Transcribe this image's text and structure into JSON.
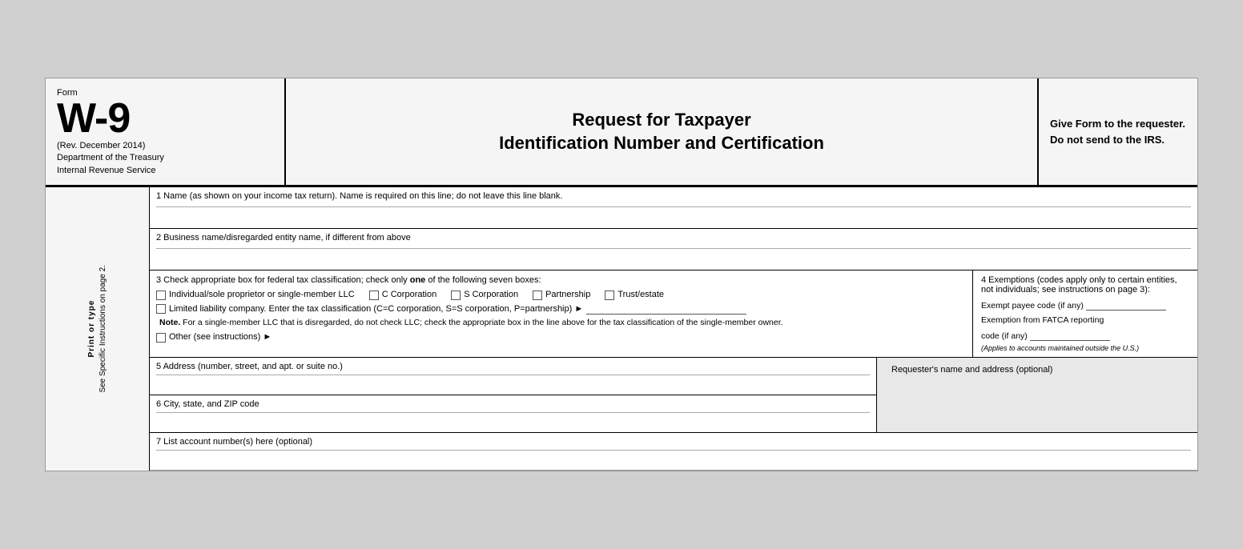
{
  "header": {
    "form_label": "Form",
    "form_number": "W-9",
    "rev_date": "(Rev. December 2014)",
    "dept_line1": "Department of the Treasury",
    "dept_line2": "Internal Revenue Service",
    "title_line1": "Request for Taxpayer",
    "title_line2": "Identification Number and Certification",
    "give_form": "Give Form to the requester. Do not send to the IRS."
  },
  "sidebar": {
    "line1": "Print or type",
    "line2": "See Specific Instructions on page 2."
  },
  "fields": {
    "field1_label": "1  Name (as shown on your income tax return). Name is required on this line; do not leave this line blank.",
    "field2_label": "2  Business name/disregarded entity name, if different from above",
    "field3_label": "3  Check appropriate box for federal tax classification; check only ",
    "field3_label_bold": "one",
    "field3_label_end": " of the following seven boxes:",
    "checkbox1": "Individual/sole proprietor or single-member LLC",
    "checkbox2": "C Corporation",
    "checkbox3": "S Corporation",
    "checkbox4": "Partnership",
    "checkbox5": "Trust/estate",
    "llc_label": "Limited liability company. Enter the tax classification (C=C corporation, S=S corporation, P=partnership) ►",
    "note_label": "Note.",
    "note_text": " For a single-member LLC that is disregarded, do not check LLC; check the appropriate box in the line above for the tax classification of the single-member owner.",
    "other_label": "Other (see instructions) ►",
    "field4_title": "4  Exemptions (codes apply only to certain entities, not individuals; see instructions on page 3):",
    "exempt_payee": "Exempt payee code (if any)",
    "fatca_exemption": "Exemption from FATCA reporting",
    "fatca_code": "code (if any)",
    "fatca_note": "(Applies to accounts maintained outside the U.S.)",
    "field5_label": "5  Address (number, street, and apt. or suite no.)",
    "requesters_label": "Requester's name and address (optional)",
    "field6_label": "6  City, state, and ZIP code",
    "field7_label": "7  List account number(s) here (optional)"
  }
}
